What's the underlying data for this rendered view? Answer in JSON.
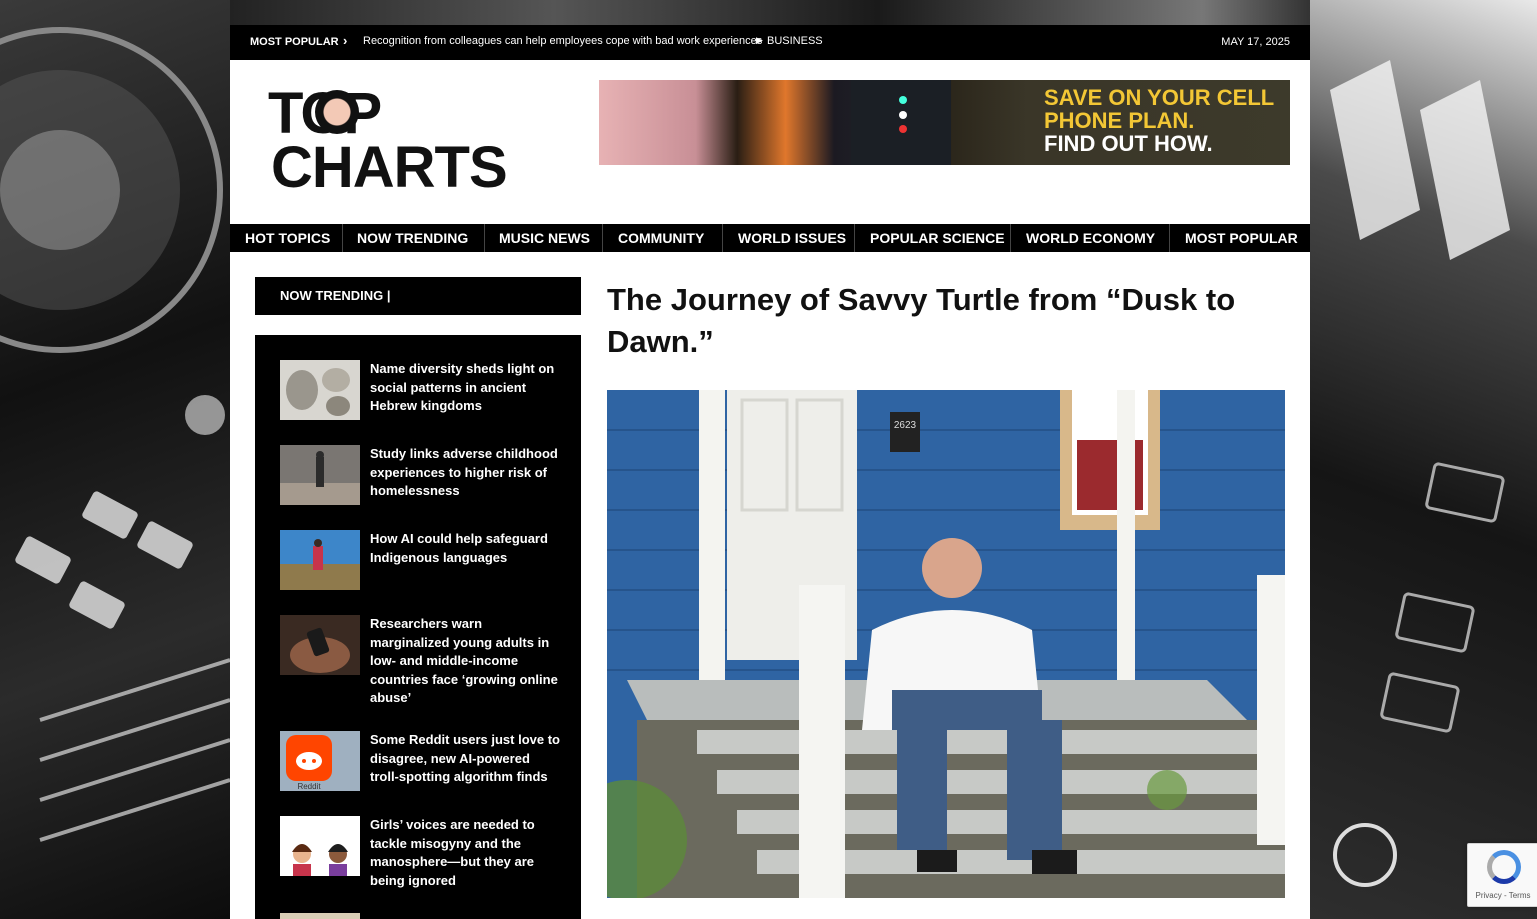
{
  "topbar": {
    "most_popular_label": "MOST POPULAR",
    "headline": "Recognition from colleagues can help employees cope with bad work experiences",
    "category": "BUSINESS",
    "date": "MAY 17, 2025"
  },
  "logo": {
    "line1": "TOP",
    "line2": "CHARTS"
  },
  "ad": {
    "line1": "SAVE ON YOUR CELL",
    "line2": "PHONE PLAN.",
    "line3": "FIND OUT HOW."
  },
  "nav": {
    "items": [
      "HOT TOPICS",
      "NOW TRENDING",
      "MUSIC NEWS",
      "COMMUNITY",
      "WORLD ISSUES",
      "POPULAR SCIENCE",
      "WORLD ECONOMY",
      "MOST POPULAR"
    ]
  },
  "sidebar": {
    "heading": "NOW TRENDING |",
    "items": [
      {
        "title": "Name diversity sheds light on social patterns in ancient Hebrew kingdoms"
      },
      {
        "title": "Study links adverse childhood experiences to higher risk of homelessness"
      },
      {
        "title": "How AI could help safeguard Indigenous languages"
      },
      {
        "title": "Researchers warn marginalized young adults in low- and middle-income countries face ‘growing online abuse’"
      },
      {
        "title": "Some Reddit users just love to disagree, new AI-powered troll-spotting algorithm finds"
      },
      {
        "title": "Girls’ voices are needed to tackle misogyny and the manosphere—but they are being ignored"
      }
    ]
  },
  "article": {
    "title": "The Journey of Savvy Turtle from “Dusk to Dawn.”",
    "house_number": "2623"
  },
  "recaptcha": {
    "label": "Privacy - Terms"
  },
  "icons": {
    "chevron": "chevron-right-icon",
    "triangle": "triangle-right-icon",
    "recaptcha": "recaptcha-icon"
  },
  "colors": {
    "bar": "#000000",
    "page": "#ffffff",
    "ad_yellow": "#f3c735",
    "house_blue": "#2e5f9a"
  }
}
